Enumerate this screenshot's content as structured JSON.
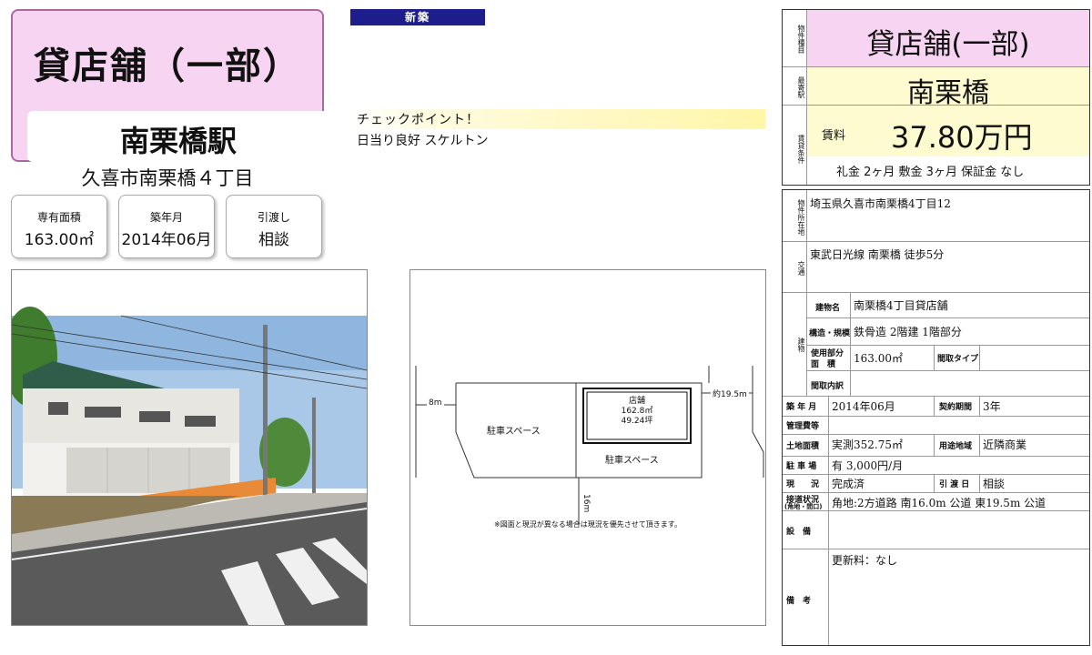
{
  "header": {
    "title": "貸店舗（一部）",
    "station": "南栗橋駅",
    "address": "久喜市南栗橋４丁目"
  },
  "specs": [
    {
      "label": "専有面積",
      "value": "163.00㎡"
    },
    {
      "label": "築年月",
      "value": "2014年06月"
    },
    {
      "label": "引渡し",
      "value": "相談"
    }
  ],
  "badge": "新築",
  "checkpoint": {
    "title": "チェックポイント！",
    "body": "日当り良好 スケルトン"
  },
  "floorplan": {
    "road_left": "8m",
    "road_right": "約19.5m",
    "road_bottom": "16m",
    "parking_left": "駐車スペース",
    "parking_bottom": "駐車スペース",
    "store_label": "店舗",
    "store_area_m2": "162.8㎡",
    "store_area_tsubo": "49.24坪",
    "note": "※図面と現況が異なる場合は現況を優先させて頂きます。"
  },
  "info": {
    "type_label": "物件種目",
    "type_value": "貸店舗(一部)",
    "station_label": "最寄駅",
    "station_value": "南栗橋",
    "rent_label": "賃貸条件",
    "rent_caption": "賃料",
    "rent_value": "37.80万円",
    "deposit": "礼金 2ヶ月  敷金 3ヶ月  保証金 なし",
    "location_label": "物件所在地",
    "location_value": "埼玉県久喜市南栗橋4丁目12",
    "transport_label": "交通",
    "transport_value": "東武日光線 南栗橋 徒歩5分",
    "building_label": "建物",
    "building_name_label": "建物名",
    "building_name": "南栗橋4丁目貸店舗",
    "structure_label": "構造・規模",
    "structure_value": "鉄骨造 2階建 1階部分",
    "area_label1": "使用部分",
    "area_label2": "面　積",
    "area_value": "163.00㎡",
    "layout_type_label": "間取タイプ",
    "layout_type_value": "",
    "layout_detail_label": "間取内訳",
    "layout_detail_value": "",
    "built_label": "築 年 月",
    "built_value": "2014年06月",
    "contract_label": "契約期間",
    "contract_value": "3年",
    "mgmt_label": "管理費等",
    "mgmt_value": "",
    "land_label": "土地面積",
    "land_value": "実測352.75㎡",
    "zone_label": "用途地域",
    "zone_value": "近隣商業",
    "parking_label": "駐 車 場",
    "parking_value": "有 3,000円/月",
    "status_label": "現　　況",
    "status_value": "完成済",
    "handover_label": "引 渡 日",
    "handover_value": "相談",
    "road_label1": "接道状況",
    "road_label2": "(角地・間口)",
    "road_value": "角地:2方道路 南16.0m 公道 東19.5m 公道",
    "facility_label": "設　備",
    "facility_value": "",
    "remarks_label": "備　考",
    "remarks_value": "更新料：なし"
  },
  "colors": {
    "header_pink": "#f7d4f2",
    "cream": "#fffbd0",
    "badge_navy": "#1d1d8c"
  }
}
